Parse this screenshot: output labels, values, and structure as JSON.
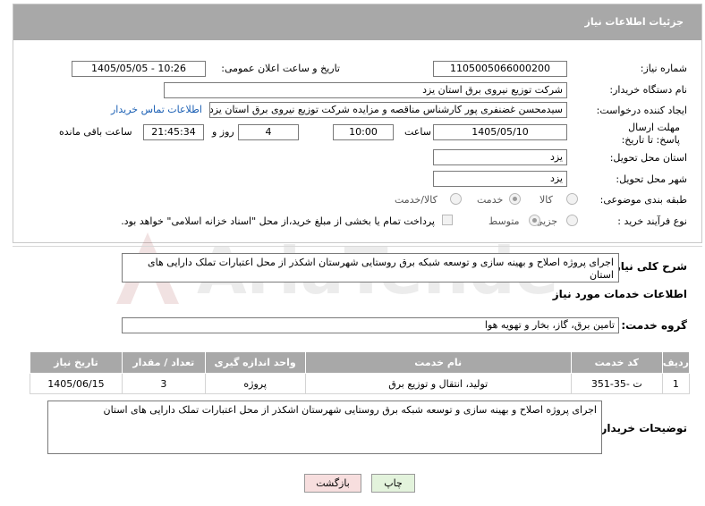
{
  "header": {
    "title": "جزئیات اطلاعات نیاز"
  },
  "fields": {
    "need_number_label": "شماره نیاز:",
    "need_number": "1105005066000200",
    "announce_label": "تاریخ و ساعت اعلان عمومی:",
    "announce_value": "1405/05/05 - 10:26",
    "buyer_org_label": "نام دستگاه خریدار:",
    "buyer_org": "شرکت توزیع نیروی برق استان یزد",
    "requester_label": "ایجاد کننده درخواست:",
    "requester": "سیدمحسن غضنفری پور کارشناس مناقصه و مزایده شرکت توزیع نیروی برق استان یزد",
    "contact_link": "اطلاعات تماس خریدار",
    "deadline_label": "مهلت ارسال پاسخ: تا تاریخ:",
    "deadline_date": "1405/05/10",
    "time_label": "ساعت",
    "deadline_time": "10:00",
    "days_value": "4",
    "days_label": "روز و",
    "remaining_time": "21:45:34",
    "remaining_label": "ساعت باقی مانده",
    "province_label": "استان محل تحویل:",
    "province": "یزد",
    "city_label": "شهر محل تحویل:",
    "city": "یزد",
    "category_label": "طبقه بندی موضوعی:",
    "category_options": [
      "کالا",
      "خدمت",
      "کالا/خدمت"
    ],
    "process_label": "نوع فرآیند خرید :",
    "process_options": [
      "جزیی",
      "متوسط"
    ],
    "payment_note": "پرداخت تمام یا بخشی از مبلغ خرید،از محل \"اسناد خزانه اسلامی\" خواهد بود."
  },
  "description": {
    "label": "شرح کلی نیاز:",
    "text": "اجرای پروژه اصلاح و بهینه سازی و توسعه شبکه برق روستایی شهرستان اشکذر از محل اعتبارات تملک دارایی های استان"
  },
  "services": {
    "section_title": "اطلاعات خدمات مورد نیاز",
    "group_label": "گروه خدمت:",
    "group_value": "تامین برق، گاز، بخار و تهویه هوا",
    "columns": [
      "ردیف",
      "کد خدمت",
      "نام خدمت",
      "واحد اندازه گیری",
      "تعداد / مقدار",
      "تاریخ نیاز"
    ],
    "rows": [
      [
        "1",
        "ت -35-351",
        "تولید، انتقال و توزیع برق",
        "پروژه",
        "3",
        "1405/06/15"
      ]
    ]
  },
  "buyer_notes": {
    "label": "توضیحات خریدار:",
    "text": "اجرای پروژه اصلاح و بهینه سازی و توسعه شبکه برق روستایی شهرستان اشکذر از محل اعتبارات تملک دارایی های استان"
  },
  "buttons": {
    "print": "چاپ",
    "back": "بازگشت"
  },
  "watermark": "AriaTender.net",
  "colors": {
    "header": "#a8a8a8",
    "link": "#1a5fb4",
    "back_button": "#f7dede",
    "print_button": "#e3f3dc"
  }
}
